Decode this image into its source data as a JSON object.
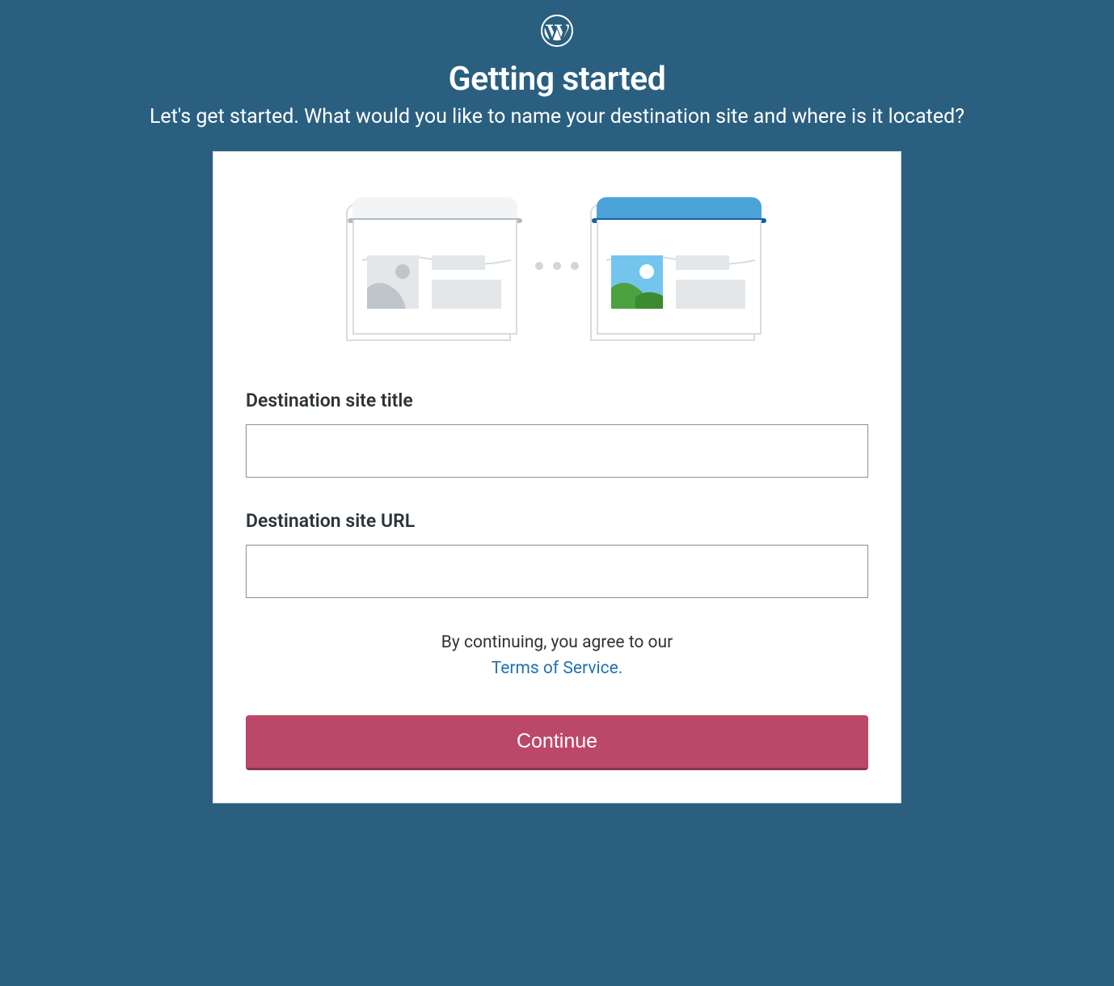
{
  "header": {
    "title": "Getting started",
    "subtitle": "Let's get started. What would you like to name your destination site and where is it located?"
  },
  "form": {
    "site_title": {
      "label": "Destination site title",
      "value": ""
    },
    "site_url": {
      "label": "Destination site URL",
      "value": ""
    }
  },
  "terms": {
    "prefix": "By continuing, you agree to our",
    "link_text": "Terms of Service."
  },
  "continue_button": "Continue",
  "colors": {
    "background": "#2a5f80",
    "card": "#ffffff",
    "primary_button": "#bc4869",
    "link": "#2271b1"
  }
}
